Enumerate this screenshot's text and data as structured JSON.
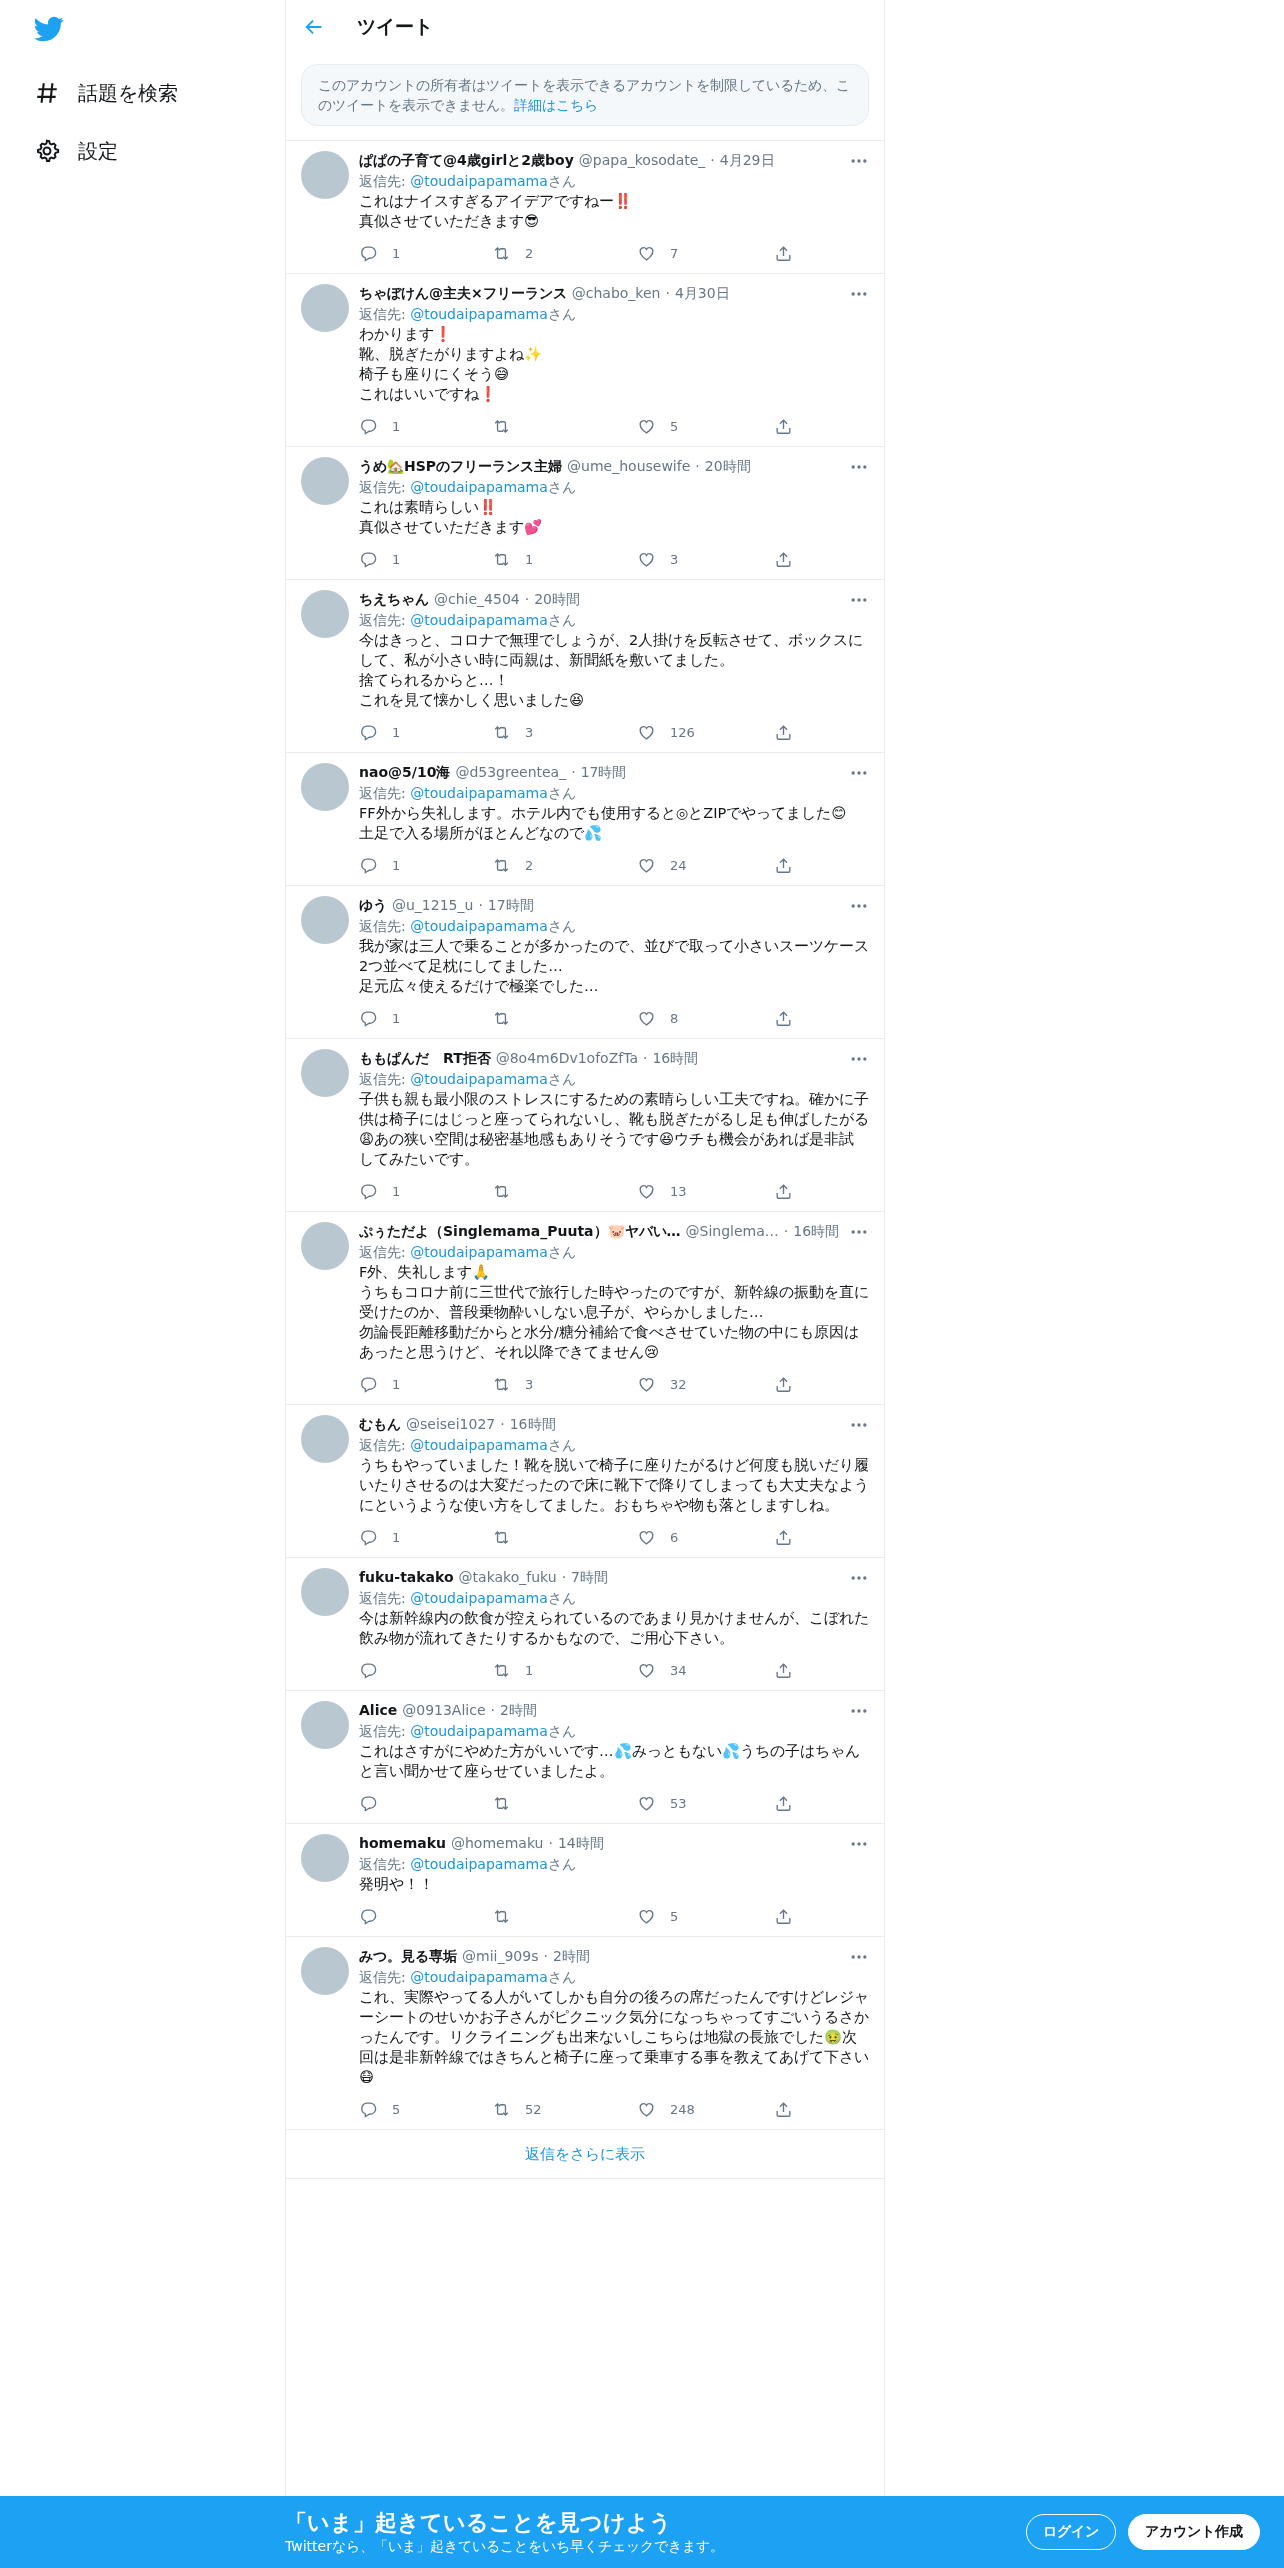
{
  "sidebar": {
    "items": [
      {
        "kind": "hashtag",
        "label": "話題を検索"
      },
      {
        "kind": "settings",
        "label": "設定"
      }
    ]
  },
  "header": {
    "title": "ツイート"
  },
  "notice": {
    "text": "このアカウントの所有者はツイートを表示できるアカウントを制限しているため、このツイートを表示できません。",
    "link": "詳細はこちら"
  },
  "tweets": [
    {
      "name": "ぱぱの子育て@4歳girlと2歳boy",
      "handle": "@papa_kosodate_",
      "dot": "·",
      "time": "4月29日",
      "reply_label": "返信先: ",
      "reply_to": "@toudaipapamama",
      "reply_suffix": "さん",
      "lines": [
        "これはナイスすぎるアイデアですねー‼️",
        "真似させていただきます😎"
      ],
      "replies": "1",
      "retweets": "2",
      "likes": "7"
    },
    {
      "name": "ちゃぼけん@主夫×フリーランス",
      "handle": "@chabo_ken",
      "dot": "·",
      "time": "4月30日",
      "reply_label": "返信先: ",
      "reply_to": "@toudaipapamama",
      "reply_suffix": "さん",
      "lines": [
        "わかります❗",
        "靴、脱ぎたがりますよね✨",
        "椅子も座りにくそう😅",
        "これはいいですね❗"
      ],
      "replies": "1",
      "likes": "5"
    },
    {
      "name": "うめ🏡HSPのフリーランス主婦",
      "handle": "@ume_housewife",
      "dot": "·",
      "time": "20時間",
      "reply_label": "返信先: ",
      "reply_to": "@toudaipapamama",
      "reply_suffix": "さん",
      "lines": [
        "これは素晴らしい‼️",
        "真似させていただきます💕"
      ],
      "replies": "1",
      "retweets": "1",
      "likes": "3"
    },
    {
      "name": "ちえちゃん",
      "handle": "@chie_4504",
      "dot": "·",
      "time": "20時間",
      "reply_label": "返信先: ",
      "reply_to": "@toudaipapamama",
      "reply_suffix": "さん",
      "lines": [
        "今はきっと、コロナで無理でしょうが、2人掛けを反転させて、ボックスにして、私が小さい時に両親は、新聞紙を敷いてました。",
        "捨てられるからと…！",
        "これを見て懐かしく思いました😆"
      ],
      "replies": "1",
      "retweets": "3",
      "likes": "126"
    },
    {
      "name": "nao@5/10海",
      "handle": "@d53greentea_",
      "dot": "·",
      "time": "17時間",
      "reply_label": "返信先: ",
      "reply_to": "@toudaipapamama",
      "reply_suffix": "さん",
      "lines": [
        "FF外から失礼します。ホテル内でも使用すると◎とZIPでやってました😊",
        "土足で入る場所がほとんどなので💦"
      ],
      "replies": "1",
      "retweets": "2",
      "likes": "24"
    },
    {
      "name": "ゆう",
      "handle": "@u_1215_u",
      "dot": "·",
      "time": "17時間",
      "reply_label": "返信先: ",
      "reply_to": "@toudaipapamama",
      "reply_suffix": "さん",
      "lines": [
        "我が家は三人で乗ることが多かったので、並びで取って小さいスーツケース2つ並べて足枕にしてました…",
        "足元広々使えるだけで極楽でした…"
      ],
      "replies": "1",
      "likes": "8"
    },
    {
      "name": "ももぱんだ　RT拒否",
      "handle": "@8o4m6Dv1ofoZfTa",
      "dot": "·",
      "time": "16時間",
      "reply_label": "返信先: ",
      "reply_to": "@toudaipapamama",
      "reply_suffix": "さん",
      "lines": [
        "子供も親も最小限のストレスにするための素晴らしい工夫ですね。確かに子供は椅子にはじっと座ってられないし、靴も脱ぎたがるし足も伸ばしたがる😩あの狭い空間は秘密基地感もありそうです😆ウチも機会があれば是非試してみたいです。"
      ],
      "replies": "1",
      "likes": "13"
    },
    {
      "name": "ぷぅただよ（Singlemama_Puuta）🐷ヤバい…",
      "handle": "@Singlema…",
      "dot": "·",
      "time": "16時間",
      "reply_label": "返信先: ",
      "reply_to": "@toudaipapamama",
      "reply_suffix": "さん",
      "lines": [
        "F外、失礼します🙏",
        "うちもコロナ前に三世代で旅行した時やったのですが、新幹線の振動を直に受けたのか、普段乗物酔いしない息子が、やらかしました…",
        "勿論長距離移動だからと水分/糖分補給で食べさせていた物の中にも原因はあったと思うけど、それ以降できてません😢"
      ],
      "replies": "1",
      "retweets": "3",
      "likes": "32"
    },
    {
      "name": "むもん",
      "handle": "@seisei1027",
      "dot": "·",
      "time": "16時間",
      "reply_label": "返信先: ",
      "reply_to": "@toudaipapamama",
      "reply_suffix": "さん",
      "lines": [
        "うちもやっていました！靴を脱いで椅子に座りたがるけど何度も脱いだり履いたりさせるのは大変だったので床に靴下で降りてしまっても大丈夫なようにというような使い方をしてました。おもちゃや物も落としますしね。"
      ],
      "replies": "1",
      "likes": "6"
    },
    {
      "name": "fuku-takako",
      "handle": "@takako_fuku",
      "dot": "·",
      "time": "7時間",
      "reply_label": "返信先: ",
      "reply_to": "@toudaipapamama",
      "reply_suffix": "さん",
      "lines": [
        "今は新幹線内の飲食が控えられているのであまり見かけませんが、こぼれた飲み物が流れてきたりするかもなので、ご用心下さい。"
      ],
      "retweets": "1",
      "likes": "34"
    },
    {
      "name": "Alice",
      "handle": "@0913Alice",
      "dot": "·",
      "time": "2時間",
      "reply_label": "返信先: ",
      "reply_to": "@toudaipapamama",
      "reply_suffix": "さん",
      "lines": [
        "これはさすがにやめた方がいいです…💦みっともない💦うちの子はちゃんと言い聞かせて座らせていましたよ。"
      ],
      "likes": "53"
    },
    {
      "name": "homemaku",
      "handle": "@homemaku",
      "dot": "·",
      "time": "14時間",
      "reply_label": "返信先: ",
      "reply_to": "@toudaipapamama",
      "reply_suffix": "さん",
      "lines": [
        "発明や！！"
      ],
      "likes": "5"
    },
    {
      "name": "みつ。見る専垢",
      "handle": "@mii_909s",
      "dot": "·",
      "time": "2時間",
      "reply_label": "返信先: ",
      "reply_to": "@toudaipapamama",
      "reply_suffix": "さん",
      "lines": [
        "これ、実際やってる人がいてしかも自分の後ろの席だったんですけどレジャーシートのせいかお子さんがピクニック気分になっちゃってすごいうるさかったんです。リクライニングも出来ないしこちらは地獄の長旅でした🤢次回は是非新幹線ではきちんと椅子に座って乗車する事を教えてあげて下さい😷"
      ],
      "replies": "5",
      "retweets": "52",
      "likes": "248"
    }
  ],
  "show_more": "返信をさらに表示",
  "bottom_bar": {
    "title": "「いま」起きていることを見つけよう",
    "subtitle": "Twitterなら、「いま」起きていることをいち早くチェックできます。",
    "buttons": [
      {
        "kind": "outline",
        "label": "ログイン"
      },
      {
        "kind": "filled",
        "label": "アカウント作成"
      }
    ]
  }
}
